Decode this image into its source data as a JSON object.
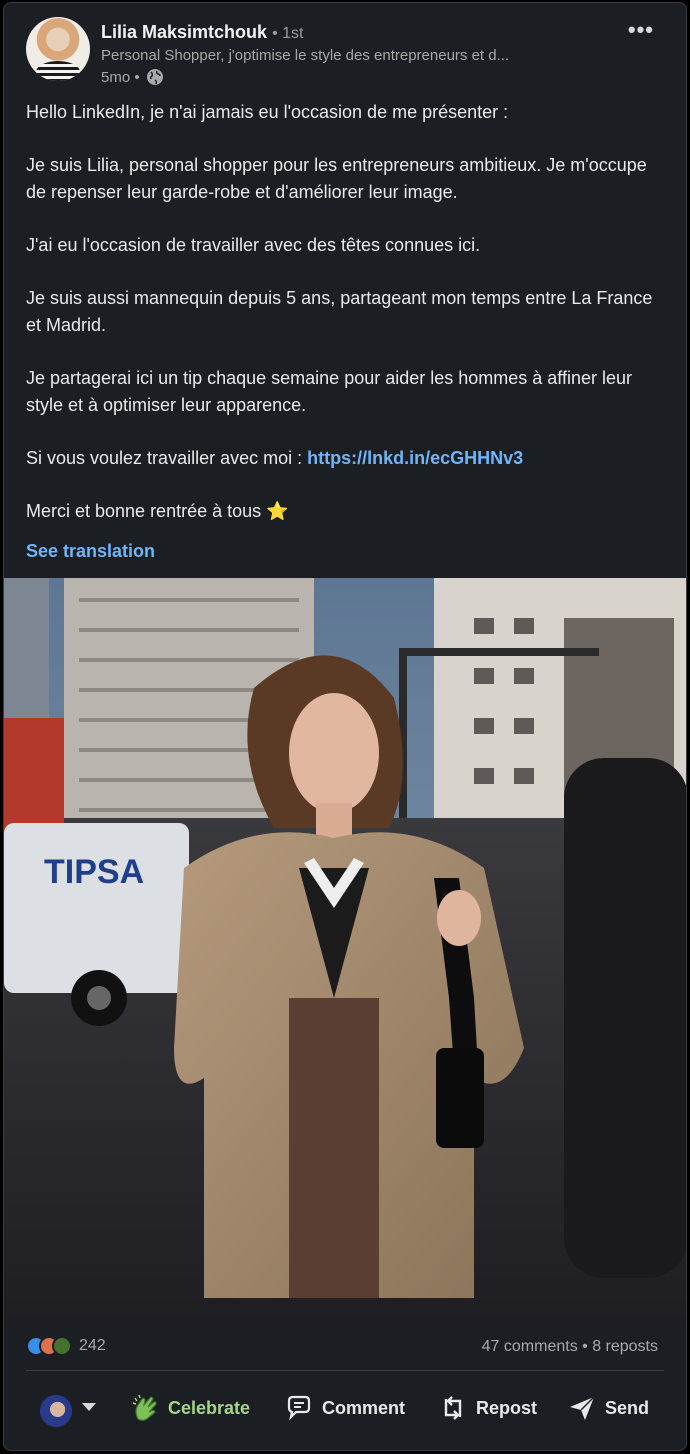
{
  "post": {
    "author": {
      "name": "Lilia Maksimtchouk",
      "degree": "• 1st",
      "headline": "Personal Shopper, j'optimise le style des entrepreneurs et d...",
      "time": "5mo •"
    },
    "paragraphs": [
      "Hello LinkedIn, je n'ai jamais eu l'occasion de me présenter :",
      "Je suis Lilia, personal shopper pour les entrepreneurs ambitieux. Je m'occupe de repenser leur garde-robe et d'améliorer leur image.",
      "J'ai eu l'occasion de travailler avec des têtes connues ici.",
      "Je suis aussi mannequin depuis 5 ans, partageant mon temps entre La France et Madrid.",
      "Je partagerai ici un tip chaque semaine pour aider les hommes à affiner leur style et à optimiser leur apparence."
    ],
    "link_prefix": "Si vous voulez travailler avec moi : ",
    "link_text": "https://lnkd.in/ecGHHNv3",
    "closing": "Merci et bonne rentrée à tous ⭐",
    "see_translation": "See translation",
    "photo_sign_text": "TIPSA",
    "reaction_count": "242",
    "comments_reposts": "47 comments • 8 reposts"
  },
  "actions": {
    "celebrate": "Celebrate",
    "comment": "Comment",
    "repost": "Repost",
    "send": "Send"
  },
  "colors": {
    "background": "#1b1f23",
    "link": "#70b5f9",
    "celebrate": "#a6d48b"
  },
  "icons": [
    "globe-icon",
    "more-options-icon",
    "like-reaction-icon",
    "love-reaction-icon",
    "celebrate-reaction-icon",
    "celebrate-icon",
    "comment-icon",
    "repost-icon",
    "send-icon",
    "caret-down-icon"
  ]
}
